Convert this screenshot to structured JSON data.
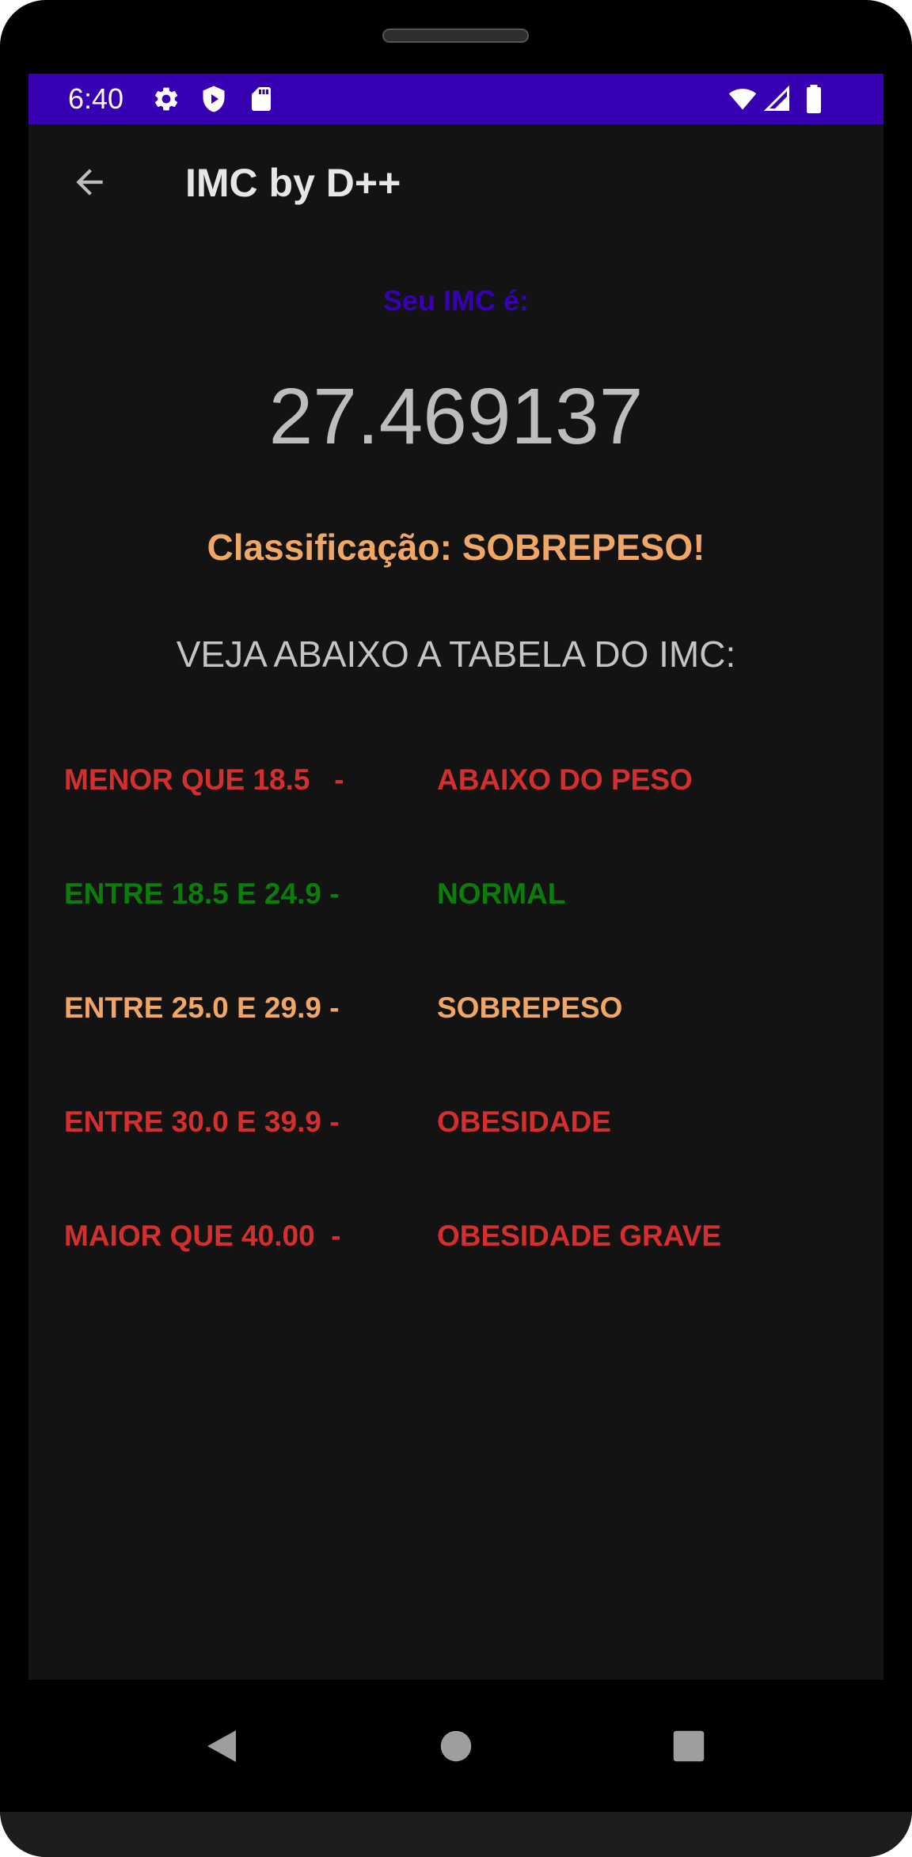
{
  "status_bar": {
    "time": "6:40",
    "background": "#3700b3",
    "left_icons": [
      "gear-icon",
      "shield-play-icon",
      "sd-card-icon"
    ],
    "right_icons": [
      "wifi-icon",
      "signal-icon",
      "battery-icon"
    ]
  },
  "app_bar": {
    "title": "IMC by D++",
    "back_icon": "arrow-back-icon"
  },
  "result": {
    "label": "Seu IMC é:",
    "value": "27.469137",
    "classification": "Classificação: SOBREPESO!"
  },
  "table": {
    "heading": "VEJA ABAIXO A TABELA DO IMC:",
    "rows": [
      {
        "range": "MENOR QUE 18.5   -",
        "category": "ABAIXO DO PESO",
        "color": "#d32f2f"
      },
      {
        "range": "ENTRE 18.5 E 24.9 -",
        "category": "NORMAL",
        "color": "#0a7d0a"
      },
      {
        "range": "ENTRE 25.0 E 29.9 -",
        "category": "SOBREPESO",
        "color": "#f0a766"
      },
      {
        "range": "ENTRE 30.0 E 39.9 -",
        "category": "OBESIDADE",
        "color": "#d32f2f"
      },
      {
        "range": "MAIOR QUE 40.00  -",
        "category": "OBESIDADE GRAVE",
        "color": "#d32f2f"
      }
    ]
  },
  "colors": {
    "accent": "#3700b3",
    "overweight": "#f0a766",
    "normal": "#0a7d0a",
    "warning": "#d32f2f",
    "screen_background": "#131313"
  },
  "nav_bar": {
    "icons": [
      "nav-back-icon",
      "nav-home-icon",
      "nav-recents-icon"
    ]
  }
}
